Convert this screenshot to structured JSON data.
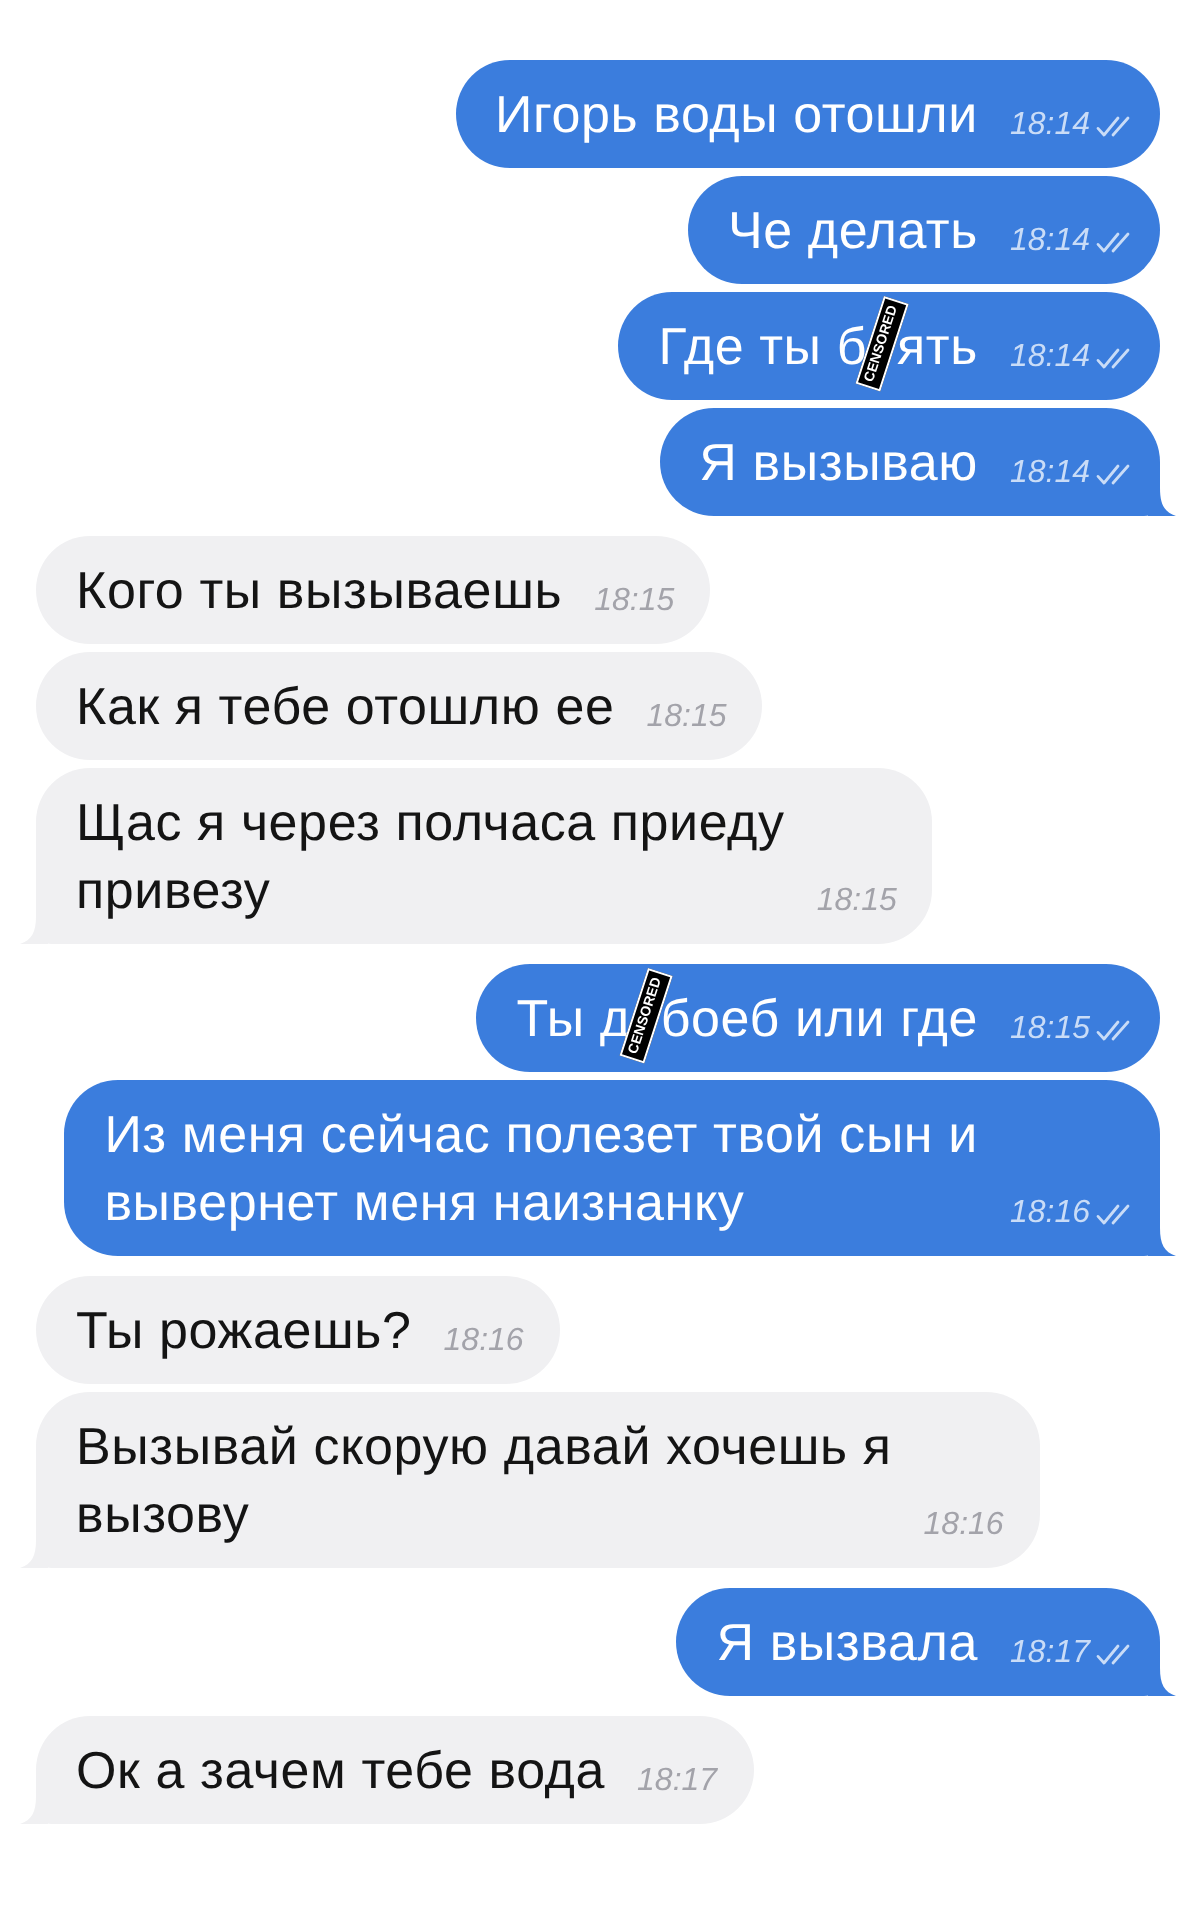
{
  "messages": [
    {
      "kind": "outgoing",
      "text": "Игорь воды отошли",
      "time": "18:14",
      "read": true,
      "tail": false
    },
    {
      "kind": "outgoing",
      "text": "Че делать",
      "time": "18:14",
      "read": true,
      "tail": false
    },
    {
      "kind": "outgoing",
      "segments": [
        {
          "kind": "text",
          "text": "Где ты б"
        },
        {
          "kind": "stamp",
          "text": "CENSORED"
        },
        {
          "kind": "text",
          "text": "ять"
        }
      ],
      "time": "18:14",
      "read": true,
      "tail": false
    },
    {
      "kind": "outgoing",
      "text": "Я вызываю",
      "time": "18:14",
      "read": true,
      "tail": true
    },
    {
      "kind": "incoming",
      "text": "Кого ты вызываешь",
      "time": "18:15",
      "tail": false
    },
    {
      "kind": "incoming",
      "text": "Как я тебе отошлю ее",
      "time": "18:15",
      "tail": false
    },
    {
      "kind": "incoming",
      "text": "Щас я через полчаса приеду\nпривезу",
      "time": "18:15",
      "tail": true
    },
    {
      "kind": "outgoing",
      "segments": [
        {
          "kind": "text",
          "text": "Ты д"
        },
        {
          "kind": "stamp",
          "text": "CENSORED"
        },
        {
          "kind": "text",
          "text": "боеб или где"
        }
      ],
      "time": "18:15",
      "read": true,
      "tail": false
    },
    {
      "kind": "outgoing",
      "text": "Из меня сейчас полезет твой сын и\nвывернет меня наизнанку",
      "time": "18:16",
      "read": true,
      "tail": true
    },
    {
      "kind": "incoming",
      "text": "Ты рожаешь?",
      "time": "18:16",
      "tail": false
    },
    {
      "kind": "incoming",
      "text": "Вызывай скорую давай хочешь я\nвызову",
      "time": "18:16",
      "tail": true
    },
    {
      "kind": "outgoing",
      "text": "Я вызвала",
      "time": "18:17",
      "read": true,
      "tail": true
    },
    {
      "kind": "incoming",
      "text": "Ок а зачем тебе вода",
      "time": "18:17",
      "tail": true
    }
  ]
}
